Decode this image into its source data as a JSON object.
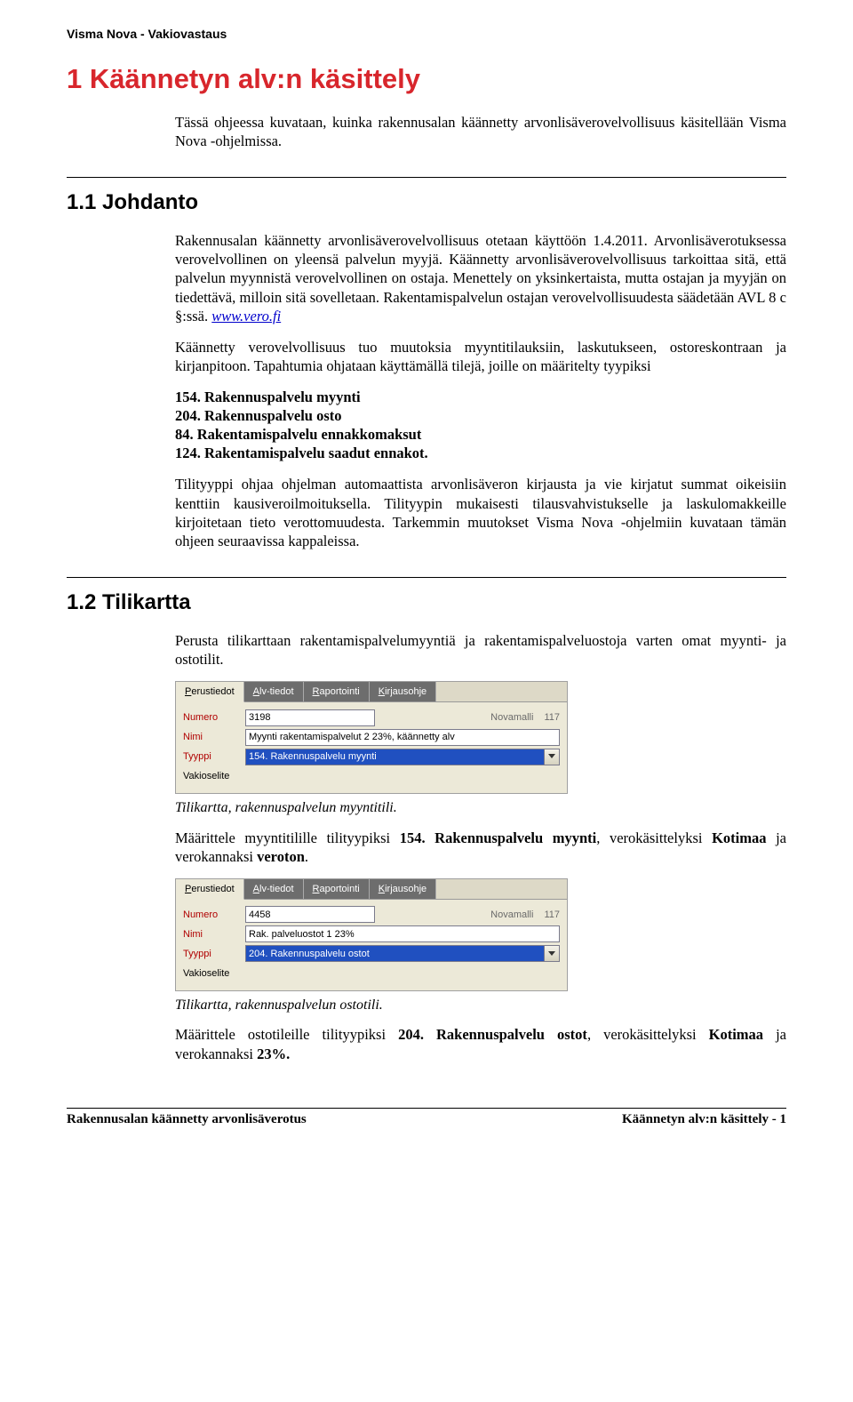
{
  "header": {
    "brand": "Visma Nova - Vakiovastaus"
  },
  "h1": "1   Käännetyn alv:n käsittely",
  "intro": "Tässä ohjeessa kuvataan, kuinka rakennusalan käännetty arvonlisäverovelvollisuus käsitellään Visma Nova -ohjelmissa.",
  "sec1": {
    "title": "1.1  Johdanto",
    "p1a": "Rakennusalan käännetty arvonlisäverovelvollisuus otetaan käyttöön 1.4.2011. Arvonlisäverotuksessa verovelvollinen on yleensä palvelun myyjä. Käännetty arvonlisäverovelvollisuus tarkoittaa sitä, että palvelun myynnistä verovelvollinen on ostaja. Menettely on yksinkertaista, mutta ostajan ja myyjän on tiedettävä, milloin sitä sovelletaan. Rakentamispalvelun ostajan verovelvollisuudesta säädetään AVL 8 c §:ssä. ",
    "link": "www.vero.fi",
    "p2": "Käännetty verovelvollisuus tuo muutoksia myyntitilauksiin, laskutukseen, ostoreskontraan ja kirjanpitoon. Tapahtumia ohjataan käyttämällä tilejä, joille on määritelty tyypiksi",
    "list": [
      "154. Rakennuspalvelu myynti",
      "204. Rakennuspalvelu osto",
      "84. Rakentamispalvelu ennakkomaksut",
      "124. Rakentamispalvelu saadut ennakot."
    ],
    "p3": "Tilityyppi ohjaa ohjelman automaattista arvonlisäveron kirjausta ja vie kirjatut summat oikeisiin kenttiin kausiveroilmoituksella. Tilityypin mukaisesti tilausvahvistukselle ja laskulomakkeille kirjoitetaan tieto verottomuudesta. Tarkemmin muutokset Visma Nova -ohjelmiin kuvataan tämän ohjeen seuraavissa kappaleissa."
  },
  "sec2": {
    "title": "1.2  Tilikartta",
    "p1": "Perusta tilikarttaan rakentamispalvelumyyntiä ja rakentamispalveluostoja varten omat myynti- ja ostotilit.",
    "shot1": {
      "tabs": [
        "Perustiedot",
        "Alv-tiedot",
        "Raportointi",
        "Kirjausohje"
      ],
      "numero_label": "Numero",
      "numero_value": "3198",
      "extra1": "Novamalli",
      "extra2": "117",
      "nimi_label": "Nimi",
      "nimi_value": "Myynti rakentamispalvelut 2 23%, käännetty alv",
      "tyyppi_label": "Tyyppi",
      "tyyppi_value": "154. Rakennuspalvelu myynti",
      "vakio_label": "Vakioselite"
    },
    "caption1": "Tilikartta, rakennuspalvelun myyntitili.",
    "p2a": "Määrittele myyntitilille tilityypiksi ",
    "p2b": "154. Rakennuspalvelu myynti",
    "p2c": ", verokäsittelyksi ",
    "p2d": "Kotimaa",
    "p2e": " ja verokannaksi ",
    "p2f": "veroton",
    "p2g": ".",
    "shot2": {
      "tabs": [
        "Perustiedot",
        "Alv-tiedot",
        "Raportointi",
        "Kirjausohje"
      ],
      "numero_label": "Numero",
      "numero_value": "4458",
      "extra1": "Novamalli",
      "extra2": "117",
      "nimi_label": "Nimi",
      "nimi_value": "Rak. palveluostot 1 23%",
      "tyyppi_label": "Tyyppi",
      "tyyppi_value": "204. Rakennuspalvelu ostot",
      "vakio_label": "Vakioselite"
    },
    "caption2": "Tilikartta, rakennuspalvelun ostotili.",
    "p3a": "Määrittele ostotileille tilityypiksi ",
    "p3b": "204. Rakennuspalvelu ostot",
    "p3c": ", verokäsittelyksi ",
    "p3d": "Kotimaa",
    "p3e": " ja verokannaksi ",
    "p3f": "23%.",
    "p3g": ""
  },
  "footer": {
    "left": "Rakennusalan käännetty arvonlisäverotus",
    "right": "Käännetyn alv:n käsittely - 1"
  }
}
